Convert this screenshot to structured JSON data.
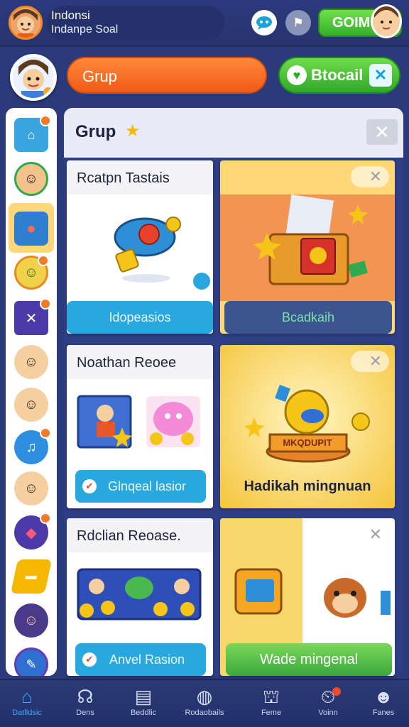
{
  "header": {
    "title_line1": "Indonsi",
    "title_line2": "Indanpe Soal",
    "coin_label": "GOIM"
  },
  "profile": {
    "group_pill": "Grup",
    "green_pill": "Btocail"
  },
  "panel": {
    "title": "Grup"
  },
  "cards": {
    "c1": {
      "title": "Rcatpn Tastais",
      "button": "Idopeasios",
      "right_button": "Bcadkaih"
    },
    "c2": {
      "title": "Noathan Reoee",
      "button": "Glnqeal lasior",
      "right_text": "Hadikah mingnuan",
      "right_badge": "MKQDUPIT"
    },
    "c3": {
      "title": "Rdclian Reoase.",
      "button": "Anvel Rasion",
      "right_button": "Wade mingenal"
    }
  },
  "bottom_nav": {
    "items": [
      {
        "label": "Datlldsic",
        "icon": "home-icon",
        "active": true
      },
      {
        "label": "Dens",
        "icon": "headset-icon",
        "active": false
      },
      {
        "label": "Beddlic",
        "icon": "document-icon",
        "active": false
      },
      {
        "label": "Rodaobails",
        "icon": "globe-icon",
        "active": false
      },
      {
        "label": "Feme",
        "icon": "shop-icon",
        "active": false
      },
      {
        "label": "Voinn",
        "icon": "notification-icon",
        "active": false
      },
      {
        "label": "Fanes",
        "icon": "profile-icon",
        "active": false
      }
    ]
  },
  "colors": {
    "background": "#2b3a7a",
    "accent_orange": "#f05a16",
    "accent_green": "#35b02c",
    "accent_blue": "#29a8e0"
  }
}
